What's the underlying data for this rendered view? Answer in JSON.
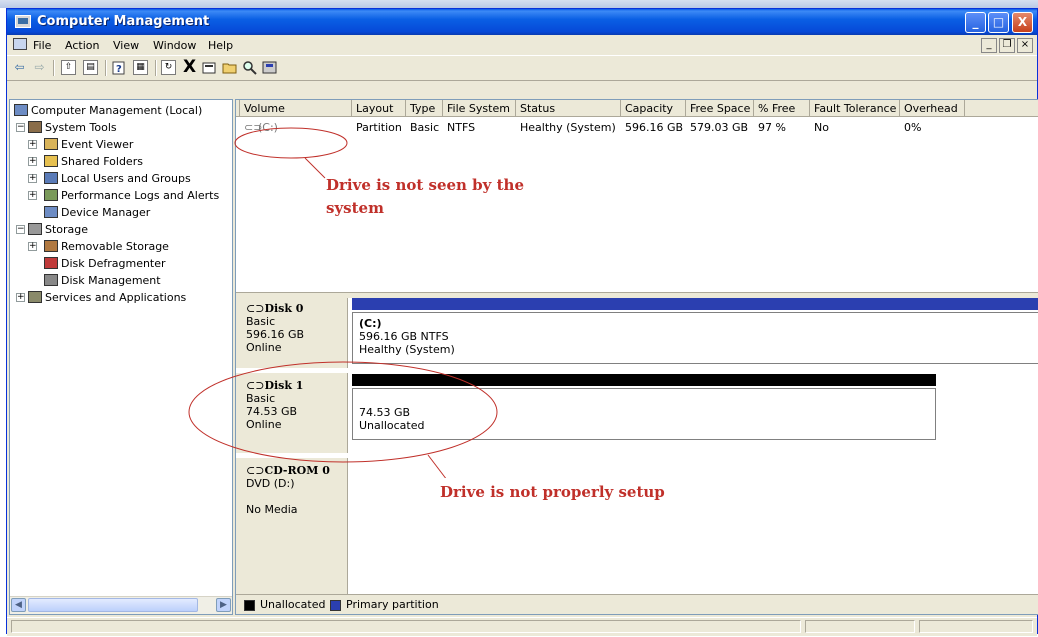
{
  "window": {
    "title": "Computer Management"
  },
  "title_buttons": {
    "minimize": "_",
    "maximize": "□",
    "close": "X"
  },
  "menu": [
    "File",
    "Action",
    "View",
    "Window",
    "Help"
  ],
  "mdi_buttons": {
    "minimize": "_",
    "restore": "❐",
    "close": "×"
  },
  "toolbar": {
    "back": "⇦",
    "forward": "⇨",
    "delete": "X"
  },
  "tree": [
    {
      "label": "Computer Management (Local)",
      "icon": "computer-icon",
      "expander": ""
    },
    {
      "label": "System Tools",
      "icon": "tools-icon",
      "expander": "−"
    },
    {
      "label": "Event Viewer",
      "icon": "event-viewer-icon",
      "expander": "+"
    },
    {
      "label": "Shared Folders",
      "icon": "shared-folder-icon",
      "expander": "+"
    },
    {
      "label": "Local Users and Groups",
      "icon": "users-icon",
      "expander": "+"
    },
    {
      "label": "Performance Logs and Alerts",
      "icon": "performance-icon",
      "expander": "+"
    },
    {
      "label": "Device Manager",
      "icon": "device-manager-icon",
      "expander": ""
    },
    {
      "label": "Storage",
      "icon": "storage-icon",
      "expander": "−"
    },
    {
      "label": "Removable Storage",
      "icon": "removable-storage-icon",
      "expander": "+"
    },
    {
      "label": "Disk Defragmenter",
      "icon": "defrag-icon",
      "expander": ""
    },
    {
      "label": "Disk Management",
      "icon": "disk-management-icon",
      "expander": ""
    },
    {
      "label": "Services and Applications",
      "icon": "services-icon",
      "expander": "+"
    }
  ],
  "volume_table": {
    "headers": [
      "Volume",
      "Layout",
      "Type",
      "File System",
      "Status",
      "Capacity",
      "Free Space",
      "% Free",
      "Fault Tolerance",
      "Overhead"
    ],
    "rows": [
      [
        "(C:)",
        "Partition",
        "Basic",
        "NTFS",
        "Healthy (System)",
        "596.16 GB",
        "579.03 GB",
        "97 %",
        "No",
        "0%"
      ]
    ]
  },
  "disks": [
    {
      "name": "Disk 0",
      "type": "Basic",
      "size": "596.16 GB",
      "state": "Online",
      "partition": {
        "title": "(C:)",
        "line1": "596.16 GB NTFS",
        "line2": "Healthy (System)"
      }
    },
    {
      "name": "Disk 1",
      "type": "Basic",
      "size": "74.53 GB",
      "state": "Online",
      "partition": {
        "line1": "74.53 GB",
        "line2": "Unallocated"
      }
    },
    {
      "name": "CD-ROM 0",
      "type": "DVD (D:)",
      "state": "No Media"
    }
  ],
  "legend": [
    {
      "label": "Unallocated",
      "color": "#000000"
    },
    {
      "label": "Primary partition",
      "color": "#2b3fb0"
    }
  ],
  "annotations": {
    "top_line1": "Drive is not seen by the",
    "top_line2": "system",
    "bottom": "Drive is not properly setup"
  },
  "colors": {
    "title_bar": "#0a5be6",
    "primary_partition": "#2b3fb0",
    "unallocated": "#000000",
    "annotation": "#c0302a"
  }
}
